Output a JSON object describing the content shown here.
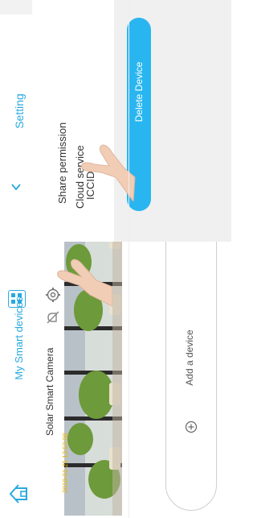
{
  "left_screen": {
    "title": "My Smart devices",
    "camera_name": "Solar Smart Camera",
    "timestamp": "2019-01-25 13:53:08",
    "add_device_label": "Add a device",
    "icons": [
      "home-icon",
      "grid-icon",
      "gear-icon",
      "bell-off-icon",
      "expand-icon",
      "plus-circle-icon"
    ]
  },
  "right_screen": {
    "title": "Setting",
    "menu": [
      "Share permission",
      "Cloud service",
      "ICCID"
    ],
    "delete_label": "Delete Device",
    "icons": [
      "back-chevron-icon"
    ]
  },
  "colors": {
    "accent": "#29a9e0",
    "delete_button": "#29b6f0",
    "panel_grey": "#f0f0f0"
  }
}
